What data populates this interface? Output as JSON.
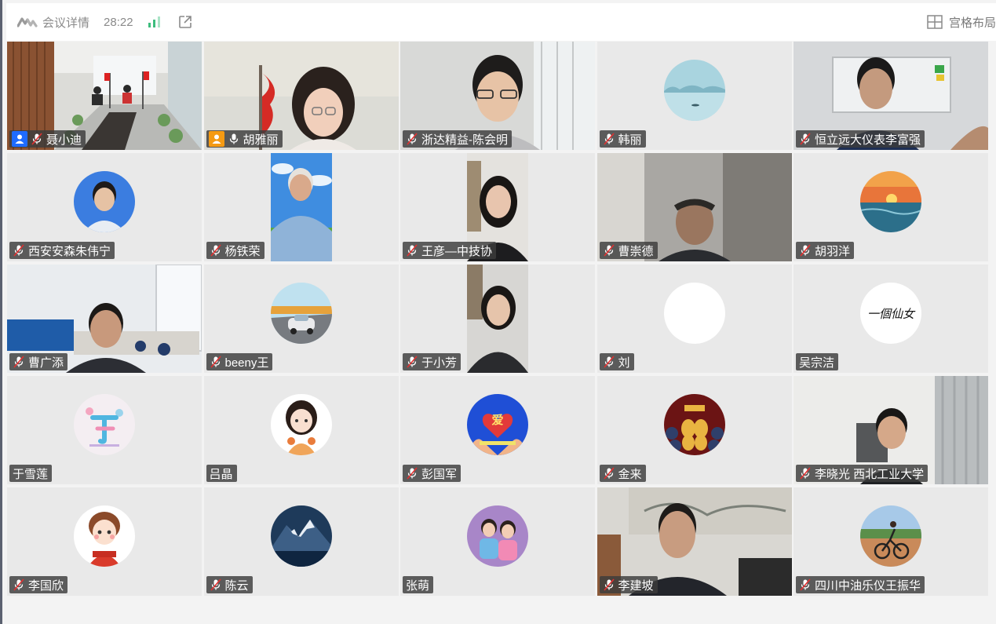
{
  "header": {
    "meeting_details_label": "会议详情",
    "timer": "28:22",
    "layout_label": "宫格布局",
    "icons": {
      "logo": "tencent-meeting-logo",
      "signal": "signal-bars-icon",
      "share": "open-external-icon",
      "layout": "grid-layout-icon"
    }
  },
  "colors": {
    "host_badge_blue": "#1f6bff",
    "cohost_badge_orange": "#f59a12",
    "tile_bg": "#e9e9e9",
    "signal_green": "#3dbd7d"
  },
  "participants": [
    {
      "name": "聂小迪",
      "badge": "host",
      "mic": "muted",
      "media": "video-conference-room"
    },
    {
      "name": "胡雅丽",
      "badge": "cohost",
      "mic": "on",
      "media": "video-woman-glasses"
    },
    {
      "name": "浙达精益-陈会明",
      "mic": "muted",
      "media": "video-man-glasses"
    },
    {
      "name": "韩丽",
      "mic": "muted",
      "media": "avatar-lake"
    },
    {
      "name": "恒立远大仪表李富强",
      "mic": "muted",
      "media": "video-man-office"
    },
    {
      "name": "西安安森朱伟宁",
      "mic": "muted",
      "media": "avatar-man-blue"
    },
    {
      "name": "杨铁荣",
      "mic": "muted",
      "media": "video-portrait-old-man"
    },
    {
      "name": "王彦—中技协",
      "mic": "muted",
      "media": "video-portrait-woman"
    },
    {
      "name": "曹崇德",
      "mic": "muted",
      "media": "video-man-dark-room"
    },
    {
      "name": "胡羽洋",
      "mic": "muted",
      "media": "avatar-sunset-sea"
    },
    {
      "name": "曹广添",
      "mic": "muted",
      "media": "video-man-blue-office"
    },
    {
      "name": "beeny王",
      "mic": "muted",
      "media": "avatar-car-road"
    },
    {
      "name": "于小芳",
      "mic": "muted",
      "media": "video-portrait-woman2"
    },
    {
      "name": "刘",
      "mic": "muted",
      "media": "avatar-white"
    },
    {
      "name": "吴宗洁",
      "mic": "none",
      "media": "avatar-calligraphy",
      "avatar_text": "一個仙女"
    },
    {
      "name": "于雪莲",
      "mic": "none",
      "media": "avatar-colorful-logo"
    },
    {
      "name": "吕晶",
      "mic": "none",
      "media": "avatar-cartoon-girl"
    },
    {
      "name": "彭国军",
      "mic": "muted",
      "media": "avatar-love-heart",
      "avatar_text": "爱"
    },
    {
      "name": "金来",
      "mic": "muted",
      "media": "avatar-golden-dogs"
    },
    {
      "name": "李晓光 西北工业大学",
      "mic": "muted",
      "media": "video-man-white-room"
    },
    {
      "name": "李国欣",
      "mic": "muted",
      "media": "avatar-cartoon-boy"
    },
    {
      "name": "陈云",
      "mic": "muted",
      "media": "avatar-snow-mountain"
    },
    {
      "name": "张萌",
      "mic": "none",
      "media": "avatar-kids-photo"
    },
    {
      "name": "李建坡",
      "mic": "muted",
      "media": "video-man-suit"
    },
    {
      "name": "四川中油乐仪王振华",
      "mic": "muted",
      "media": "avatar-cyclist"
    }
  ]
}
